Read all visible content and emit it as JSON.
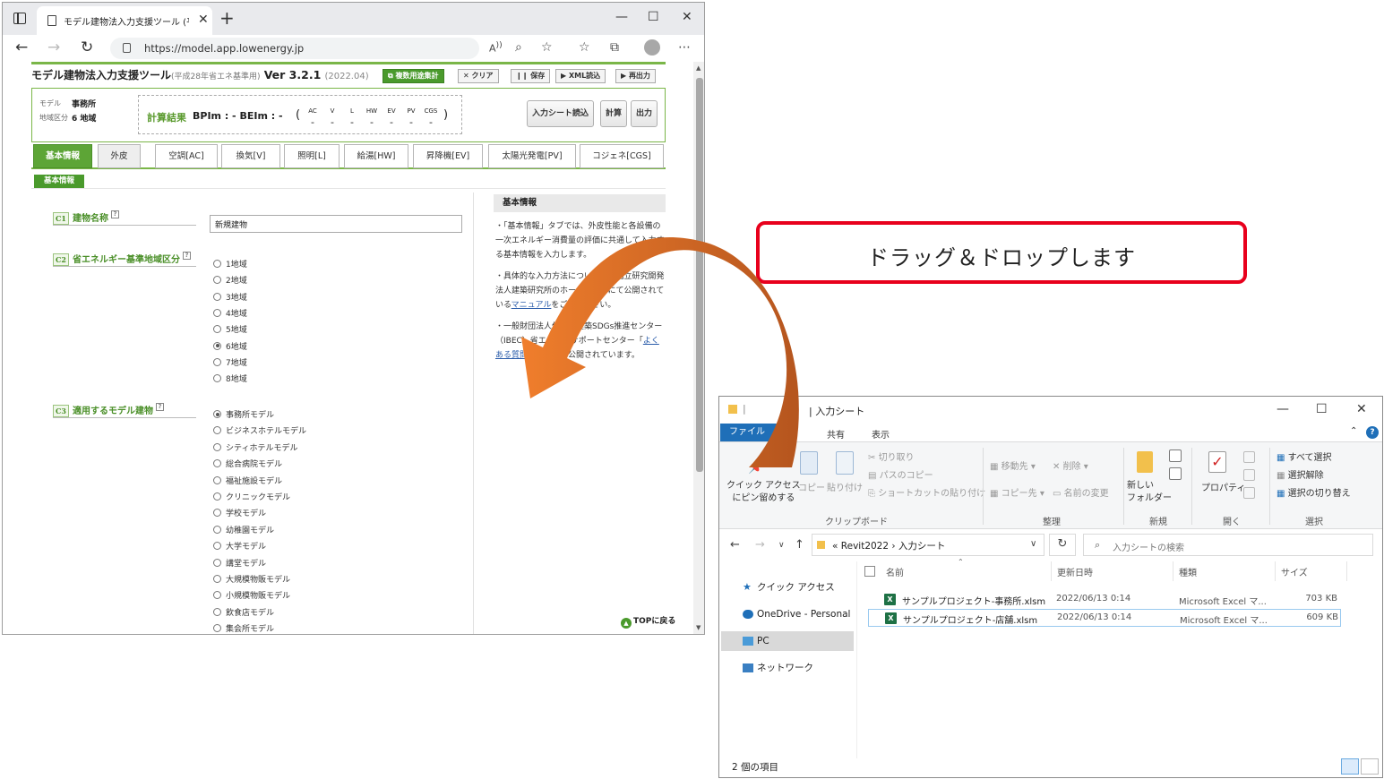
{
  "browser": {
    "tab_title": "モデル建物法入力支援ツール (平成…",
    "url": "https://model.app.lowenergy.jp",
    "window_controls": [
      "—",
      "☐",
      "✕"
    ]
  },
  "tool": {
    "title": "モデル建物法入力支援ツール",
    "subtitle": "(平成28年省エネ基準用)",
    "version": "Ver 3.2.1",
    "date": "(2022.04)",
    "header_buttons": {
      "multi": "複数用途集計",
      "clear": "クリア",
      "save": "保存",
      "xml": "XML読込",
      "output": "再出力"
    },
    "info": {
      "model_label": "モデル",
      "model_value": "事務所",
      "region_label": "地域区分",
      "region_value": "6 地域"
    },
    "calc": {
      "label": "計算結果",
      "text": "BPIm : -  BEIm : -",
      "cols": [
        "AC",
        "V",
        "L",
        "HW",
        "EV",
        "PV",
        "CGS"
      ],
      "dash": "-"
    },
    "panel_buttons": {
      "read_input": "入力シート読込",
      "calc": "計算",
      "output": "出力"
    },
    "tabs": [
      "基本情報",
      "外皮",
      "空調[AC]",
      "換気[V]",
      "照明[L]",
      "給湯[HW]",
      "昇降機[EV]",
      "太陽光発電[PV]",
      "コジェネ[CGS]"
    ],
    "section_badge": "基本情報",
    "c1": {
      "code": "C1",
      "label": "建物名称",
      "value": "新規建物"
    },
    "c2": {
      "code": "C2",
      "label": "省エネルギー基準地域区分",
      "options": [
        "1地域",
        "2地域",
        "3地域",
        "4地域",
        "5地域",
        "6地域",
        "7地域",
        "8地域"
      ],
      "selected": 5
    },
    "c3": {
      "code": "C3",
      "label": "適用するモデル建物",
      "options": [
        "事務所モデル",
        "ビジネスホテルモデル",
        "シティホテルモデル",
        "総合病院モデル",
        "福祉施設モデル",
        "クリニックモデル",
        "学校モデル",
        "幼稚園モデル",
        "大学モデル",
        "講堂モデル",
        "大規模物販モデル",
        "小規模物販モデル",
        "飲食店モデル",
        "集会所モデル"
      ],
      "selected": 0
    },
    "help_mark": "?",
    "side": {
      "head": "基本情報",
      "p1": "・「基本情報」タブでは、外皮性能と各設備の一次エネルギー消費量の評価に共通して入力する基本情報を入力します。",
      "p2_a": "・具体的な入力方法については、国立研究開発法人建築研究所のホームページにて公開されている",
      "p2_link": "マニュアル",
      "p2_b": "をご覧ください。",
      "p3_a": "・一般財団法人住宅・建築SDGs推進センター（IBEC）省エネ対策サポートセンター",
      "p3_link": "よくある質問と回答",
      "p3_b": "」が公開されています。"
    },
    "top_link": "TOPに戻る"
  },
  "callout": {
    "text": "ドラッグ＆ドロップします"
  },
  "explorer": {
    "title": "入力シート",
    "ribbon_tabs": {
      "file": "ファイル",
      "share": "共有",
      "view": "表示"
    },
    "ribbon": {
      "pin": "クイック アクセス\nにピン留めする",
      "copy": "コピー",
      "paste": "貼り付け",
      "cut": "切り取り",
      "copy_path": "パスのコピー",
      "paste_shortcut": "ショートカットの貼り付け",
      "move_to": "移動先",
      "copy_to": "コピー先",
      "delete": "削除",
      "rename": "名前の変更",
      "new_folder": "新しい\nフォルダー",
      "properties": "プロパティ",
      "select_all": "すべて選択",
      "select_none": "選択解除",
      "invert": "選択の切り替え",
      "groups": {
        "clipboard": "クリップボード",
        "organize": "整理",
        "new": "新規",
        "open": "開く",
        "select": "選択"
      }
    },
    "path": [
      "Revit2022",
      "入力シート"
    ],
    "path_prefix": "«",
    "search_placeholder": "入力シートの検索",
    "nav": [
      "クイック アクセス",
      "OneDrive - Personal",
      "PC",
      "ネットワーク"
    ],
    "columns": {
      "name": "名前",
      "date": "更新日時",
      "type": "種類",
      "size": "サイズ"
    },
    "files": [
      {
        "name": "サンプルプロジェクト-事務所.xlsm",
        "date": "2022/06/13 0:14",
        "type": "Microsoft Excel マ...",
        "size": "703 KB"
      },
      {
        "name": "サンプルプロジェクト-店舗.xlsm",
        "date": "2022/06/13 0:14",
        "type": "Microsoft Excel マ...",
        "size": "609 KB"
      }
    ],
    "status": "2 個の項目"
  },
  "colors": {
    "accent_green": "#4a9a2c",
    "callout_red": "#e8001c",
    "arrow_orange": "#e87a2e",
    "explorer_blue": "#1f6fb8"
  }
}
